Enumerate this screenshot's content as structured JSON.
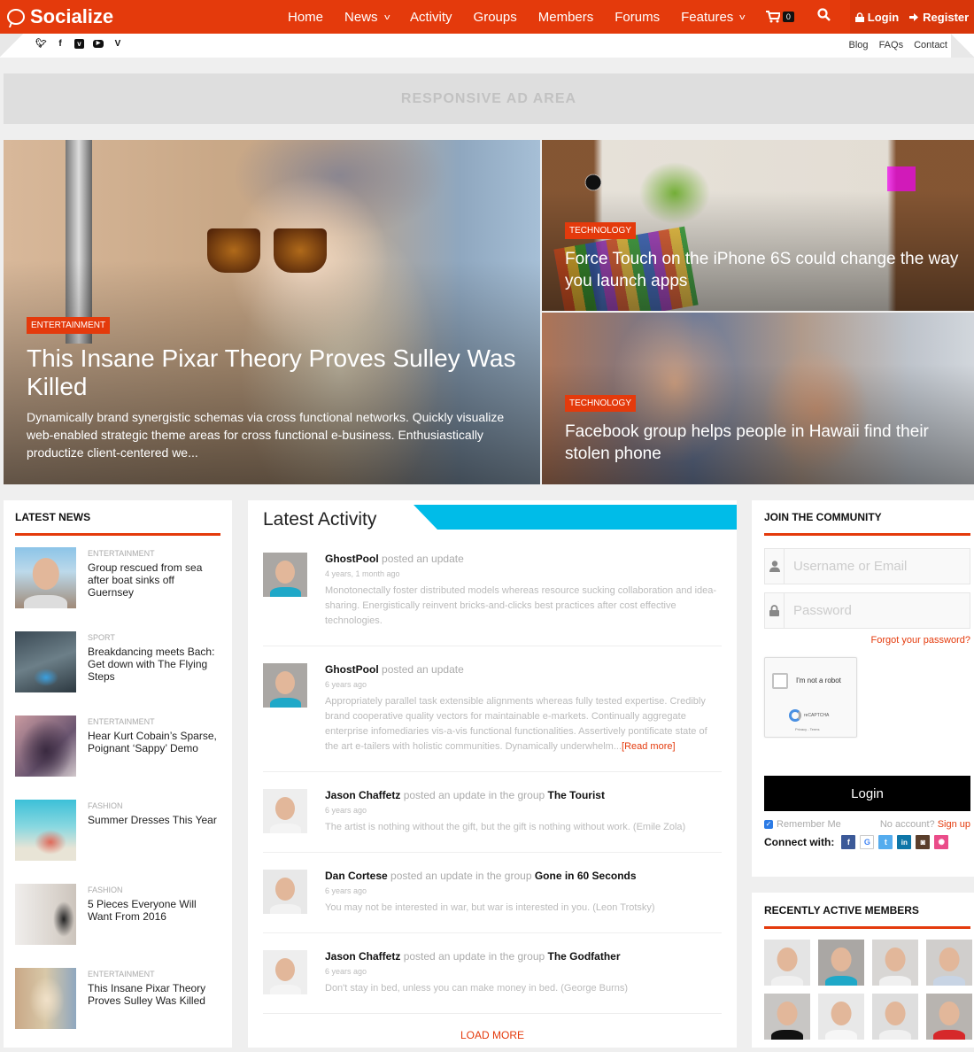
{
  "header": {
    "brand": "Socialize",
    "nav": [
      {
        "label": "Home",
        "has_dropdown": false
      },
      {
        "label": "News",
        "has_dropdown": true
      },
      {
        "label": "Activity",
        "has_dropdown": false
      },
      {
        "label": "Groups",
        "has_dropdown": false
      },
      {
        "label": "Members",
        "has_dropdown": false
      },
      {
        "label": "Forums",
        "has_dropdown": false
      },
      {
        "label": "Features",
        "has_dropdown": true
      }
    ],
    "dropdown_glyph": "⌄",
    "cart_icon": "🛒",
    "cart_count": "0",
    "search_icon": "🔍",
    "login_icon": "🔒",
    "login_label": "Login",
    "register_icon": "➜",
    "register_label": "Register",
    "brand_color": "#e43a0c"
  },
  "subbar": {
    "social": [
      {
        "name": "twitter",
        "glyph": "t"
      },
      {
        "name": "facebook",
        "glyph": "f"
      },
      {
        "name": "vimeo",
        "glyph": "v"
      },
      {
        "name": "youtube",
        "glyph": "▶"
      },
      {
        "name": "vine",
        "glyph": "V"
      }
    ],
    "links": [
      "Blog",
      "FAQs",
      "Contact"
    ]
  },
  "ad": {
    "label": "RESPONSIVE AD AREA"
  },
  "hero": {
    "main": {
      "category": "ENTERTAINMENT",
      "title": "This Insane Pixar Theory Proves Sulley Was Killed",
      "excerpt": "Dynamically brand synergistic schemas via cross functional networks. Quickly visualize web-enabled strategic theme areas for cross functional e-business. Enthusiastically productize client-centered we..."
    },
    "side": [
      {
        "category": "TECHNOLOGY",
        "title": "Force Touch on the iPhone 6S could change the way you launch apps"
      },
      {
        "category": "TECHNOLOGY",
        "title": "Facebook group helps people in Hawaii find their stolen phone"
      }
    ]
  },
  "latest_news": {
    "title": "LATEST NEWS",
    "items": [
      {
        "category": "ENTERTAINMENT",
        "title": "Group rescued from sea after boat sinks off Guernsey"
      },
      {
        "category": "SPORT",
        "title": "Breakdancing meets Bach: Get down with The Flying Steps"
      },
      {
        "category": "ENTERTAINMENT",
        "title": "Hear Kurt Cobain’s Sparse, Poignant ‘Sappy’ Demo"
      },
      {
        "category": "FASHION",
        "title": "Summer Dresses This Year"
      },
      {
        "category": "FASHION",
        "title": "5 Pieces Everyone Will Want From 2016"
      },
      {
        "category": "ENTERTAINMENT",
        "title": "This Insane Pixar Theory Proves Sulley Was Killed"
      }
    ]
  },
  "activity": {
    "title": "Latest Activity",
    "accent_color": "#00bce8",
    "items": [
      {
        "user": "GhostPool",
        "action": "posted an update",
        "group": "",
        "time": "4 years, 1 month ago",
        "text": "Monotonectally foster distributed models whereas resource sucking collaboration and idea-sharing. Energistically reinvent bricks-and-clicks best practices after cost effective technologies.",
        "read_more": ""
      },
      {
        "user": "GhostPool",
        "action": "posted an update",
        "group": "",
        "time": "6 years ago",
        "text": "Appropriately parallel task extensible alignments whereas fully tested expertise. Credibly brand cooperative quality vectors for maintainable e-markets. Continually aggregate enterprise infomediaries vis-a-vis functional functionalities. Assertively pontificate state of the art e-tailers with holistic communities. Dynamically underwhelm...",
        "read_more": "[Read more]"
      },
      {
        "user": "Jason Chaffetz",
        "action": "posted an update in the group",
        "group": "The Tourist",
        "time": "6 years ago",
        "text": "The artist is nothing without the gift, but the gift is nothing without work. (Emile Zola)",
        "read_more": ""
      },
      {
        "user": "Dan Cortese",
        "action": "posted an update in the group",
        "group": "Gone in 60 Seconds",
        "time": "6 years ago",
        "text": "You may not be interested in war, but war is interested in you. (Leon Trotsky)",
        "read_more": ""
      },
      {
        "user": "Jason Chaffetz",
        "action": "posted an update in the group",
        "group": "The Godfather",
        "time": "6 years ago",
        "text": "Don't stay in bed, unless you can make money in bed. (George Burns)",
        "read_more": ""
      }
    ],
    "load_more": "LOAD MORE"
  },
  "join": {
    "title": "JOIN THE COMMUNITY",
    "username_placeholder": "Username or Email",
    "username_value": "",
    "password_placeholder": "Password",
    "password_value": "",
    "forgot": "Forgot your password?",
    "captcha_label": "I'm not a robot",
    "captcha_brand": "reCAPTCHA",
    "captcha_terms": "Privacy - Terms",
    "login_button": "Login",
    "remember_label": "Remember Me",
    "remember_checked": true,
    "no_account": "No account?",
    "sign_up": "Sign up",
    "connect_label": "Connect with:",
    "connect_networks": [
      {
        "name": "facebook",
        "glyph": "f",
        "color": "#3b5998"
      },
      {
        "name": "google",
        "glyph": "G",
        "color": "#ffffff"
      },
      {
        "name": "twitter",
        "glyph": "t",
        "color": "#55acee"
      },
      {
        "name": "linkedin",
        "glyph": "in",
        "color": "#0e76a8"
      },
      {
        "name": "instagram",
        "glyph": "◙",
        "color": "#5a3e2b"
      },
      {
        "name": "dribbble",
        "glyph": "✺",
        "color": "#ea4c89"
      }
    ]
  },
  "members": {
    "title": "RECENTLY ACTIVE MEMBERS",
    "count_visible": 8
  }
}
